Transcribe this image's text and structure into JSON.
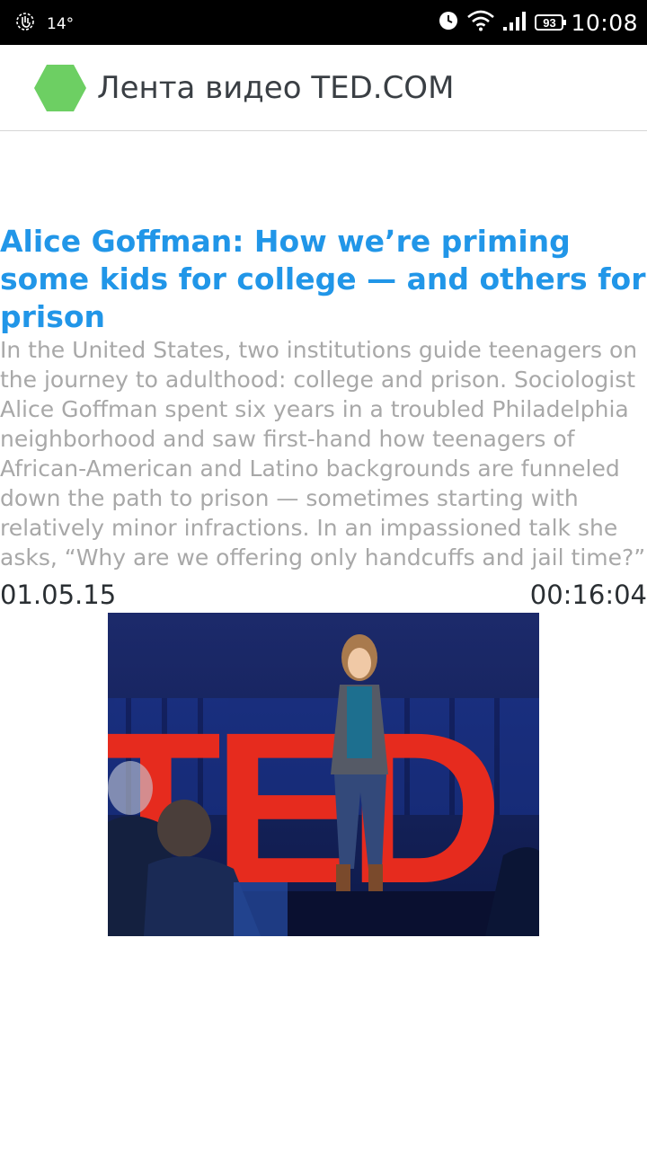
{
  "status_bar": {
    "temperature": "14°",
    "battery": "93",
    "time": "10:08",
    "icons": [
      "hand-gesture-icon",
      "alarm-clock-icon",
      "wifi-icon",
      "signal-icon",
      "battery-icon"
    ]
  },
  "app_bar": {
    "title": "Лента видео TED.COM",
    "logo_icon": "green-hexagon-icon",
    "logo_color": "#6dcf63"
  },
  "talk": {
    "title": "Alice Goffman: How we’re priming some kids for college — and others for prison",
    "description": "In the United States, two institutions guide teenagers on the journey to adulthood: college and prison. Sociologist Alice Goffman spent six years in a troubled Philadelphia neighborhood and saw first-hand how teenagers of African-American and Latino backgrounds are funneled down the path to prison — sometimes starting with relatively minor infractions. In an impassioned talk she asks, “Why are we offering only handcuffs and jail time?”",
    "date": "01.05.15",
    "duration": "00:16:04",
    "thumbnail_logo_text": "TED"
  },
  "colors": {
    "title_blue": "#2196e8",
    "description_gray": "#a8a8a8",
    "ted_red": "#e62b1e"
  }
}
